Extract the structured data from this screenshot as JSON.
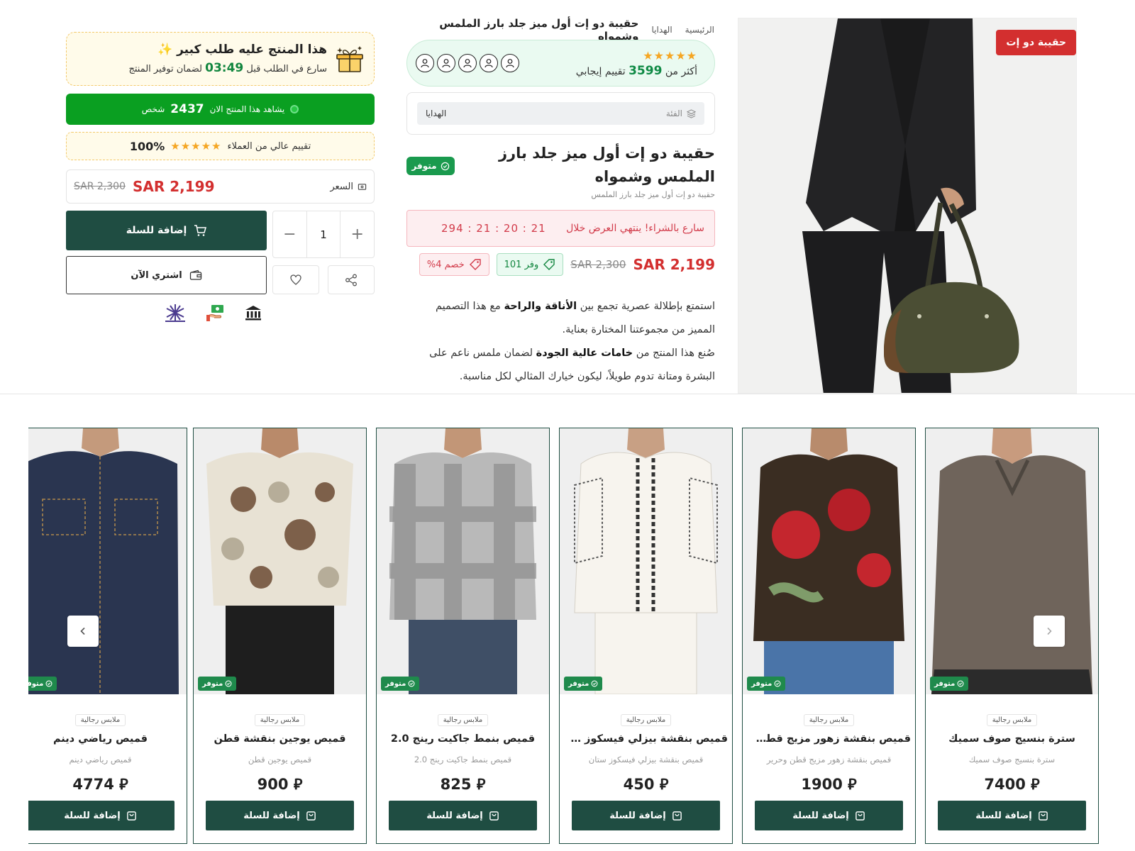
{
  "gallery": {
    "badge": "حقيبة دو إت"
  },
  "breadcrumb": {
    "home": "الرئيسية",
    "category": "الهدايا",
    "current": "حقيبة دو إت أول ميز جلد بارز الملمس وشمواه"
  },
  "rating": {
    "stars": "★★★★★",
    "prefix": "أكثر من",
    "count": "3599",
    "suffix": "تقييم إيجابي"
  },
  "category": {
    "label": "الفئة",
    "value": "الهدايا"
  },
  "product": {
    "title": "حقيبة دو إت أول ميز جلد بارز الملمس وشمواه",
    "subtitle": "حقيبة دو إت أول ميز جلد بارز الملمس",
    "stock": "متوفر"
  },
  "countdown": {
    "label": "سارع بالشراء! ينتهي العرض خلال",
    "timer": "294 : 21 : 20 : 21"
  },
  "pricing": {
    "current": "SAR 2,199",
    "old": "SAR 2,300",
    "save": "وفر 101",
    "discount": "خصم 4%"
  },
  "description": {
    "p1_a": "استمتع بإطلالة عصرية تجمع بين ",
    "p1_b": "الأناقة والراحة",
    "p1_c": " مع هذا التصميم المميز من مجموعتنا المختارة بعناية.",
    "p2_a": "صُنع هذا المنتج من ",
    "p2_b": "خامات عالية الجودة",
    "p2_c": " لضمان ملمس ناعم على البشرة ومتانة تدوم طويلاً، ليكون خيارك المثالي لكل مناسبة."
  },
  "big_order": {
    "title": "هذا المنتج عليه طلب كبير",
    "sparkle": "✨",
    "sub_prefix": "سارع في الطلب قبل",
    "time": "03:49",
    "sub_suffix": "لضمان توفير المنتج"
  },
  "viewers": {
    "prefix": "يشاهد هذا المنتج الان",
    "count": "2437",
    "suffix": "شخص"
  },
  "customer_rating": {
    "text": "تقييم عالي من العملاء",
    "stars": "★★★★★",
    "percent": "100%"
  },
  "price_box": {
    "label": "السعر",
    "current": "SAR 2,199",
    "old": "SAR 2,300"
  },
  "actions": {
    "add_to_cart": "إضافة للسلة",
    "buy_now": "اشتري الآن",
    "quantity": "1",
    "minus": "−",
    "plus": "+"
  },
  "products": [
    {
      "category": "ملابس رجالية",
      "title": "سترة بنسيج صوف سميك",
      "subtitle": "سترة بنسيج صوف سميك",
      "price": "7400",
      "stock": "متوفر",
      "button": "إضافة للسلة"
    },
    {
      "category": "ملابس رجالية",
      "title": "قميص بنقشة زهور مزيج قطن...",
      "subtitle": "قميص بنقشة زهور مزيج قطن وحرير",
      "price": "1900",
      "stock": "متوفر",
      "button": "إضافة للسلة"
    },
    {
      "category": "ملابس رجالية",
      "title": "قميص بنقشة بيزلي فيسكوز ستان",
      "subtitle": "قميص بنقشة بيزلي فيسكوز ستان",
      "price": "450",
      "stock": "متوفر",
      "button": "إضافة للسلة"
    },
    {
      "category": "ملابس رجالية",
      "title": "قميص بنمط جاكيت رينج 2.0",
      "subtitle": "قميص بنمط جاكيت رينج 2.0",
      "price": "825",
      "stock": "متوفر",
      "button": "إضافة للسلة"
    },
    {
      "category": "ملابس رجالية",
      "title": "قميص يوجين بنقشة قطن",
      "subtitle": "قميص يوجين قطن",
      "price": "900",
      "stock": "متوفر",
      "button": "إضافة للسلة"
    },
    {
      "category": "ملابس رجالية",
      "title": "قميص رياضي دينم",
      "subtitle": "قميص رياضي دينم",
      "price": "4774",
      "stock": "متوفر",
      "button": "إضافة للسلة"
    }
  ],
  "currency_symbol": "⃁",
  "colors": {
    "brand_dark": "#1f4d42",
    "sale_red": "#d32f2f",
    "success_green": "#0a9f21",
    "star": "#f5a623"
  }
}
